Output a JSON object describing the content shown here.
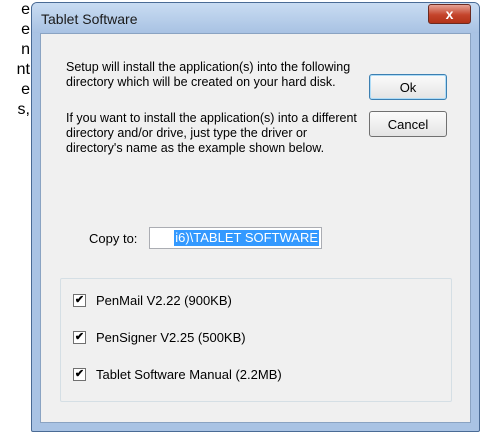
{
  "background_text": {
    "fragments": [
      "e",
      "e",
      "n",
      "nt",
      "e",
      "s,"
    ]
  },
  "window": {
    "title": "Tablet Software",
    "close_glyph": "x"
  },
  "dialog": {
    "paragraph1": "Setup will install the application(s) into the following directory which will be created on your hard disk.",
    "paragraph2": "If you want to install the application(s) into a different directory and/or drive, just type the driver or directory's name as the example shown below.",
    "ok_label": "Ok",
    "cancel_label": "Cancel",
    "copy_to_label": "Copy to:",
    "copy_to_value": "i6)\\TABLET SOFTWARE"
  },
  "components": {
    "items": [
      {
        "label": "PenMail V2.22 (900KB)",
        "checked": true
      },
      {
        "label": "PenSigner V2.25 (500KB)",
        "checked": true
      },
      {
        "label": "Tablet Software Manual (2.2MB)",
        "checked": true
      }
    ],
    "check_glyph": "✔"
  },
  "colors": {
    "titlebar": "#a9c3e4",
    "close_button": "#c4442b",
    "selection": "#3399ff"
  }
}
